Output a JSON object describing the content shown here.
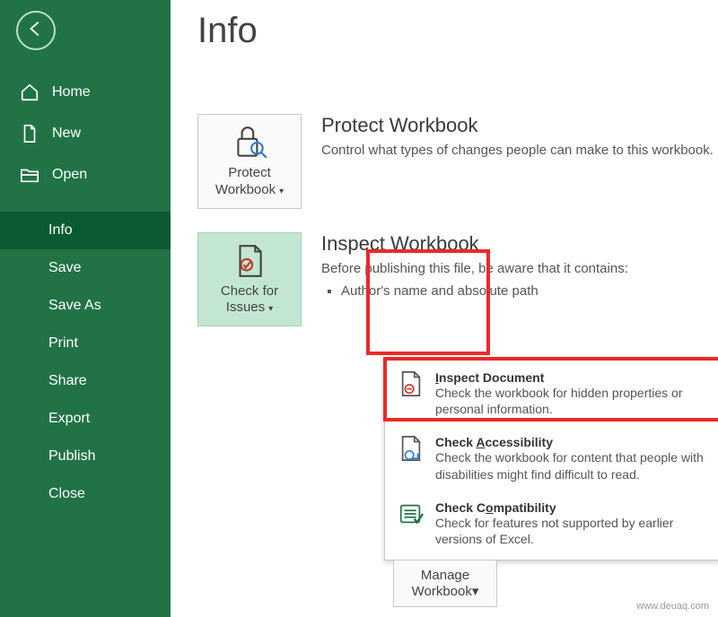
{
  "page": {
    "title": "Info"
  },
  "nav": {
    "items": [
      {
        "label": "Home"
      },
      {
        "label": "New"
      },
      {
        "label": "Open"
      },
      {
        "label": "Info"
      },
      {
        "label": "Save"
      },
      {
        "label": "Save As"
      },
      {
        "label": "Print"
      },
      {
        "label": "Share"
      },
      {
        "label": "Export"
      },
      {
        "label": "Publish"
      },
      {
        "label": "Close"
      }
    ]
  },
  "protect": {
    "btn_line1": "Protect",
    "btn_line2": "Workbook",
    "heading": "Protect Workbook",
    "desc": "Control what types of changes people can make to this workbook."
  },
  "inspect": {
    "btn_line1": "Check for",
    "btn_line2": "Issues",
    "heading": "Inspect Workbook",
    "desc": "Before publishing this file, be aware that it contains:",
    "bullet1": "Author's name and absolute path"
  },
  "menu": {
    "item1": {
      "title_pre": "I",
      "title_post": "nspect Document",
      "desc": "Check the workbook for hidden properties or personal information."
    },
    "item2": {
      "title_pre": "Check ",
      "hot": "A",
      "title_post": "ccessibility",
      "desc": "Check the workbook for content that people with disabilities might find difficult to read."
    },
    "item3": {
      "title_pre": "Check C",
      "hot": "o",
      "title_post": "mpatibility",
      "desc": "Check for features not supported by earlier versions of Excel."
    }
  },
  "manage": {
    "line1": "Manage",
    "line2": "Workbook"
  },
  "watermark": "www.deuaq.com"
}
